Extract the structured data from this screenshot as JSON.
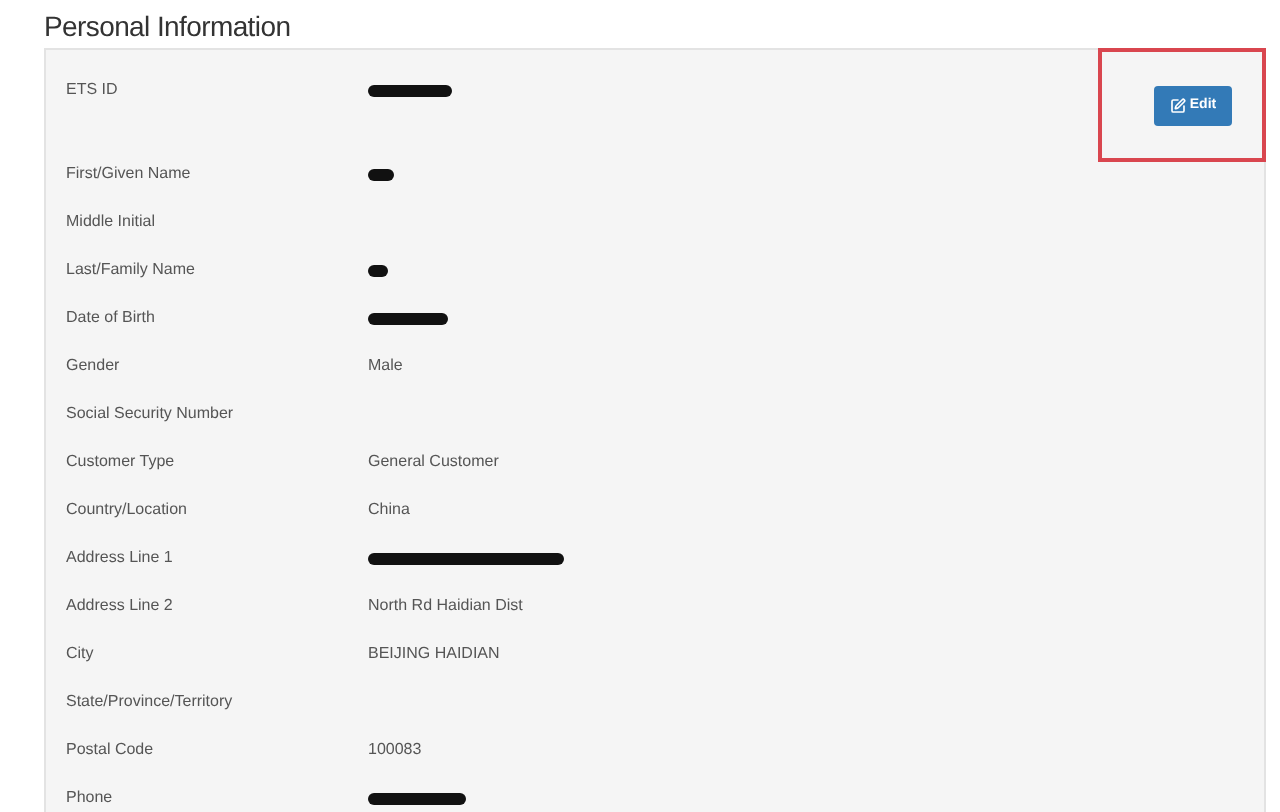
{
  "title": "Personal Information",
  "edit_button": {
    "label": "Edit",
    "highlighted": true
  },
  "fields": [
    {
      "label": "ETS ID",
      "kind": "redacted"
    },
    {
      "label": "First/Given Name",
      "kind": "redacted"
    },
    {
      "label": "Middle Initial",
      "kind": "empty"
    },
    {
      "label": "Last/Family Name",
      "kind": "redacted"
    },
    {
      "label": "Date of Birth",
      "kind": "redacted"
    },
    {
      "label": "Gender",
      "kind": "text",
      "value": "Male"
    },
    {
      "label": "Social Security Number",
      "kind": "empty"
    },
    {
      "label": "Customer Type",
      "kind": "text",
      "value": "General Customer"
    },
    {
      "label": "Country/Location",
      "kind": "text",
      "value": "China"
    },
    {
      "label": "Address Line 1",
      "kind": "redacted"
    },
    {
      "label": "Address Line 2",
      "kind": "text",
      "value": "North Rd Haidian Dist"
    },
    {
      "label": "City",
      "kind": "text",
      "value": "BEIJING HAIDIAN"
    },
    {
      "label": "State/Province/Territory",
      "kind": "empty"
    },
    {
      "label": "Postal Code",
      "kind": "text",
      "value": "100083"
    },
    {
      "label": "Phone",
      "kind": "redacted"
    }
  ]
}
